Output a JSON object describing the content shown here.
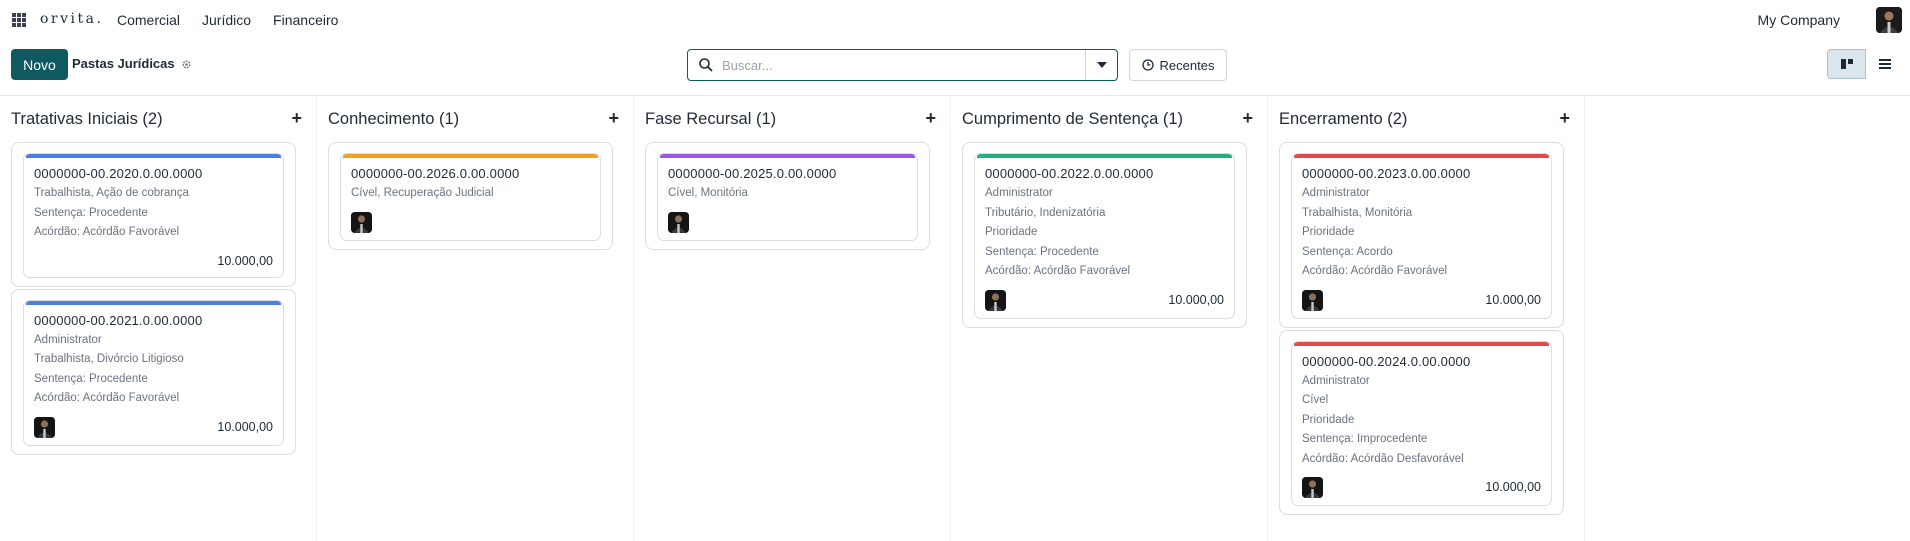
{
  "nav": {
    "brand": "orvita.",
    "items": [
      "Comercial",
      "Jurídico",
      "Financeiro"
    ],
    "company": "My Company"
  },
  "control": {
    "new_label": "Novo",
    "breadcrumb": "Pastas Jurídicas",
    "search_placeholder": "Buscar...",
    "recent_label": "Recentes"
  },
  "colors": {
    "primary": "#0f5960",
    "blue": "#4a7fe0",
    "orange": "#f0a020",
    "purple": "#9b59e0",
    "green": "#23b07d",
    "red": "#e04a4a"
  },
  "columns": [
    {
      "title": "Tratativas Iniciais (2)",
      "cards": [
        {
          "ref": "0000000-00.2020.0.00.0000",
          "color": "blue",
          "lines": [
            "Trabalhista, Ação de cobrança",
            "Sentença: Procedente",
            "Acórdão: Acórdão Favorável"
          ],
          "avatar": false,
          "amount": "10.000,00"
        },
        {
          "ref": "0000000-00.2021.0.00.0000",
          "color": "blue",
          "lines": [
            "Administrator",
            "Trabalhista, Divórcio Litigioso",
            "Sentença: Procedente",
            "Acórdão: Acórdão Favorável"
          ],
          "avatar": true,
          "amount": "10.000,00"
        }
      ]
    },
    {
      "title": "Conhecimento (1)",
      "cards": [
        {
          "ref": "0000000-00.2026.0.00.0000",
          "color": "orange",
          "lines": [
            "Cível, Recuperação Judicial"
          ],
          "avatar": true,
          "amount": ""
        }
      ]
    },
    {
      "title": "Fase Recursal (1)",
      "cards": [
        {
          "ref": "0000000-00.2025.0.00.0000",
          "color": "purple",
          "lines": [
            "Cível, Monitória"
          ],
          "avatar": true,
          "amount": ""
        }
      ]
    },
    {
      "title": "Cumprimento de Sentença (1)",
      "cards": [
        {
          "ref": "0000000-00.2022.0.00.0000",
          "color": "green",
          "lines": [
            "Administrator",
            "Tributário, Indenizatória",
            "Prioridade",
            "Sentença: Procedente",
            "Acórdão: Acórdão Favorável"
          ],
          "avatar": true,
          "amount": "10.000,00"
        }
      ]
    },
    {
      "title": "Encerramento (2)",
      "cards": [
        {
          "ref": "0000000-00.2023.0.00.0000",
          "color": "red",
          "lines": [
            "Administrator",
            "Trabalhista, Monitória",
            "Prioridade",
            "Sentença: Acordo",
            "Acórdão: Acórdão Favorável"
          ],
          "avatar": true,
          "amount": "10.000,00"
        },
        {
          "ref": "0000000-00.2024.0.00.0000",
          "color": "red",
          "lines": [
            "Administrator",
            "Cível",
            "Prioridade",
            "Sentença: Improcedente",
            "Acórdão: Acórdão Desfavorável"
          ],
          "avatar": true,
          "amount": "10.000,00"
        }
      ]
    }
  ]
}
